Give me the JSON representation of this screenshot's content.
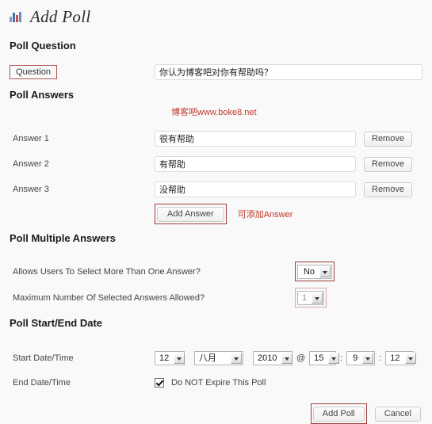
{
  "header": {
    "icon": "bar-chart-icon",
    "title": "Add Poll"
  },
  "sections": {
    "question_heading": "Poll Question",
    "answers_heading": "Poll Answers",
    "multiple_heading": "Poll Multiple Answers",
    "date_heading": "Poll Start/End Date"
  },
  "question": {
    "label": "Question",
    "value": "你认为博客吧对你有帮助吗？",
    "placeholder": ""
  },
  "watermark": "博客吧www.boke8.net",
  "answers": {
    "rows": [
      {
        "label": "Answer 1",
        "value": "很有帮助",
        "remove_label": "Remove"
      },
      {
        "label": "Answer 2",
        "value": "有帮助",
        "remove_label": "Remove"
      },
      {
        "label": "Answer 3",
        "value": "没帮助",
        "remove_label": "Remove"
      }
    ],
    "add_label": "Add Answer",
    "add_annotation": "可添加Answer"
  },
  "multiple": {
    "allow_label": "Allows Users To Select More Than One Answer?",
    "allow_value": "No",
    "max_label": "Maximum Number Of Selected Answers Allowed?",
    "max_value": "1"
  },
  "date": {
    "start_label": "Start Date/Time",
    "day": "12",
    "month": "八月",
    "year": "2010",
    "at": "@",
    "hour": "15",
    "minute": "9",
    "second": "12",
    "colon": ":",
    "end_label": "End Date/Time",
    "no_expire_label": "Do NOT Expire This Poll"
  },
  "footer": {
    "submit_label": "Add Poll",
    "cancel_label": "Cancel"
  },
  "colors": {
    "page_background": "#f9f9f9",
    "highlight_strong": "#9e3b3b",
    "highlight_soft": "#d9a8a8",
    "annotation_red": "#c0392b",
    "label_box_border": "#b05252",
    "text": "#333333"
  }
}
